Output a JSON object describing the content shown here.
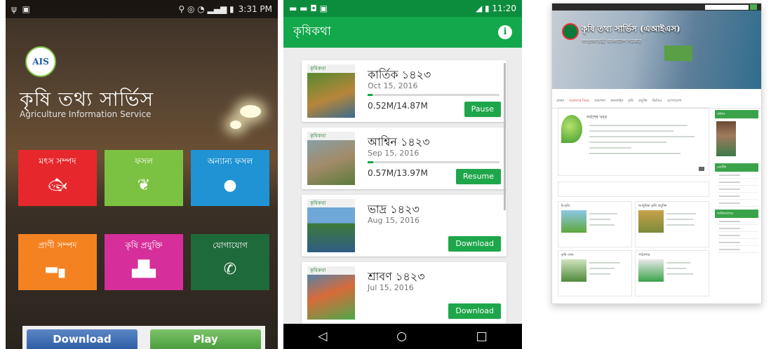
{
  "panel1": {
    "status_time": "3:31 PM",
    "logo_text": "AIS",
    "app_title": "কৃষি তথ্য সার্ভিস",
    "app_subtitle": "Agriculture Information Service",
    "tiles": [
      {
        "label": "মৎস সম্পদ",
        "icon": "fish-icon",
        "color": "#e6282d"
      },
      {
        "label": "ফসল",
        "icon": "leaf-icon",
        "color": "#7cc242"
      },
      {
        "label": "অন্যান্য ফসল",
        "icon": "onion-icon",
        "color": "#1f93d3"
      },
      {
        "label": "প্রাণী সম্পদ",
        "icon": "cow-icon",
        "color": "#f58220"
      },
      {
        "label": "কৃষি প্রযুক্তি",
        "icon": "tractor-icon",
        "color": "#d62e9a"
      },
      {
        "label": "যোগাযোগ",
        "icon": "phone-icon",
        "color": "#1f6a3a"
      }
    ],
    "download_label": "Download",
    "play_label": "Play"
  },
  "panel2": {
    "status_time": "11:20",
    "app_title": "কৃষিকথা",
    "masthead": "কৃষিকথা",
    "items": [
      {
        "title": "কার্তিক ১৪২৩",
        "date": "Oct 15, 2016",
        "size": "0.52M/14.87M",
        "progress": 0.035,
        "button": "Pause"
      },
      {
        "title": "আশ্বিন ১৪২৩",
        "date": "Sep 15, 2016",
        "size": "0.57M/13.97M",
        "progress": 0.041,
        "button": "Resume"
      },
      {
        "title": "ভাদ্র ১৪২৩",
        "date": "Aug 15, 2016",
        "button": "Download"
      },
      {
        "title": "শ্রাবণ ১৪২৩",
        "date": "Jul 15, 2016",
        "button": "Download"
      }
    ]
  },
  "panel3": {
    "site_title": "কৃষি তথ্য সার্ভিস (এআইএস)",
    "site_subtitle": "গণপ্রজাতন্ত্রী বাংলাদেশ সরকার",
    "nav_items": [
      "প্রচ্ছদ",
      "আমাদের বিষয়",
      "প্রকাশনা",
      "অনলাইন",
      "কৃষি",
      "প্রযুক্তি",
      "ভিডিও",
      "যোগাযোগ"
    ],
    "featured_heading": "সর্বশেষ খবর",
    "grid_headings": [
      "ই-কৃষি",
      "আধুনিক কৃষি প্রযুক্তি",
      "কৃষি তথ্য",
      "পাঠাগার"
    ],
    "sidebar_headings": [
      "প্রধান",
      "নোটিশ",
      "ডাউনলোড"
    ]
  }
}
